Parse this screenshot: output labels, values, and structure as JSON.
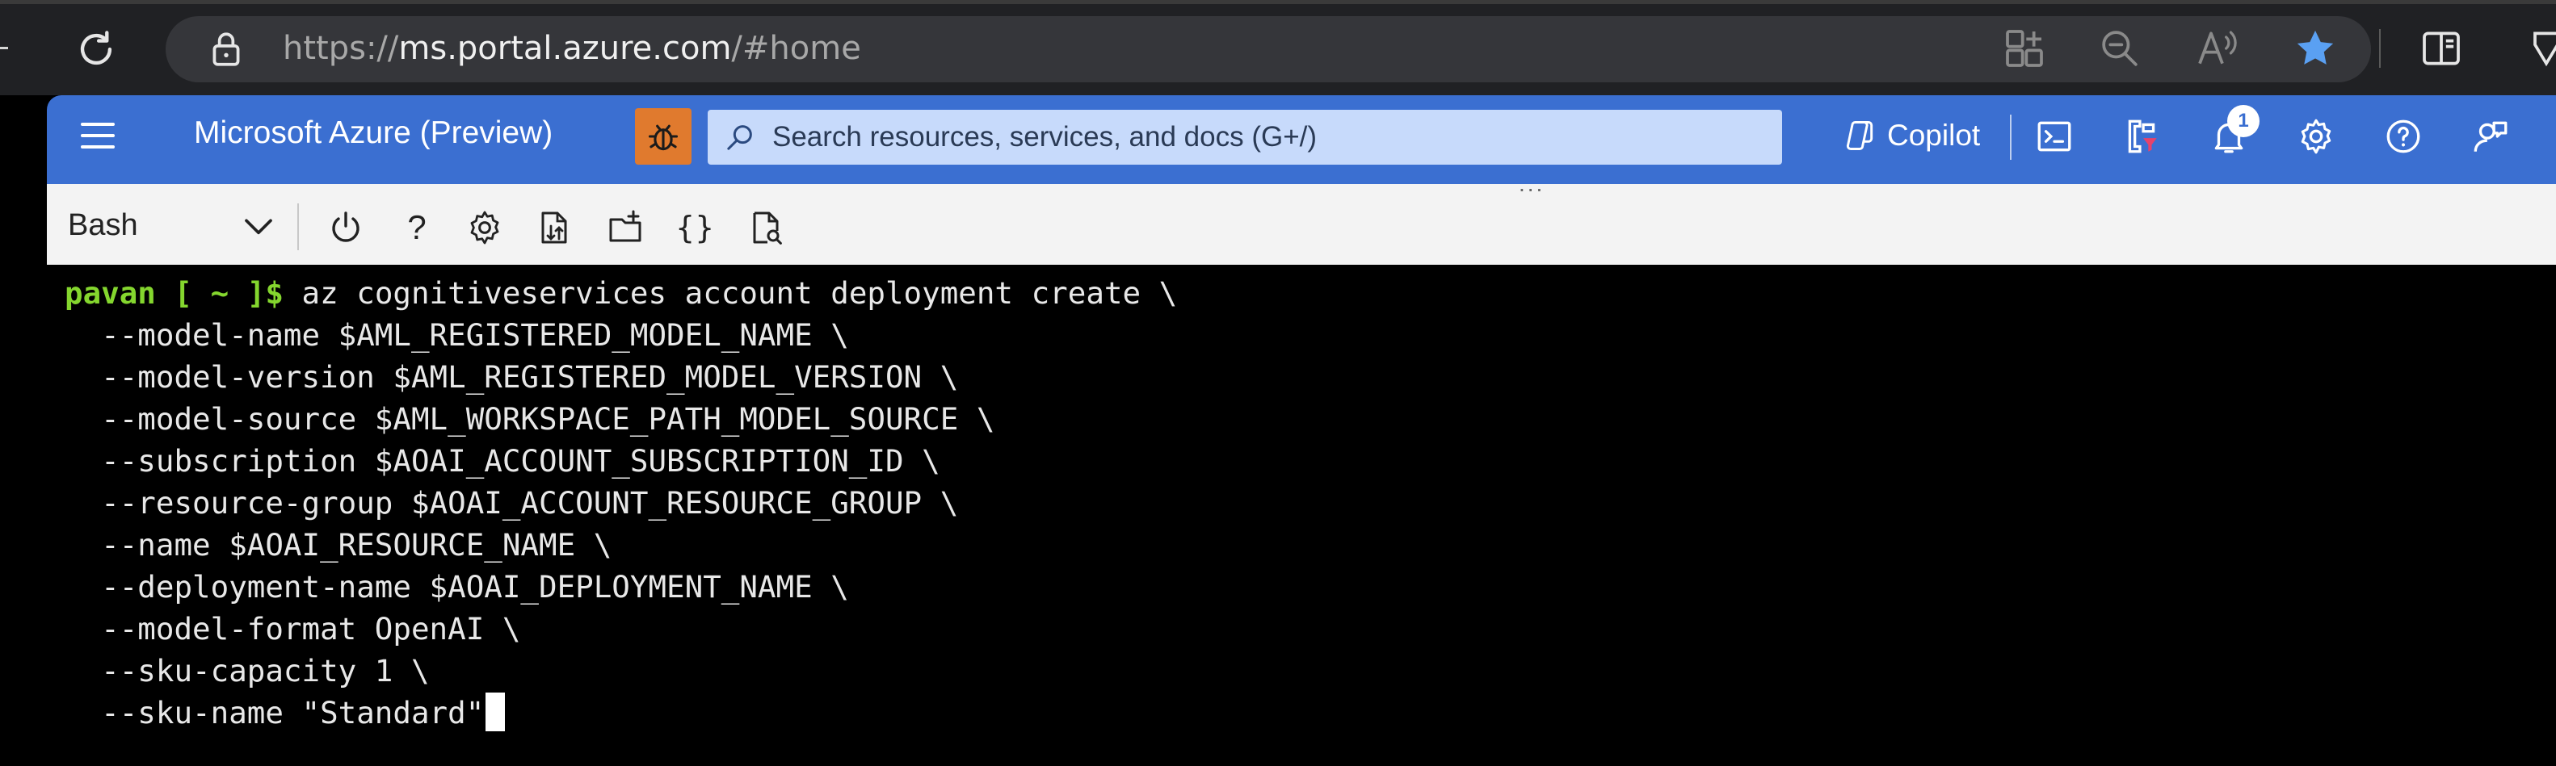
{
  "browser": {
    "url_scheme": "https://",
    "url_host": "ms.portal.azure.com",
    "url_path": "/#home"
  },
  "header": {
    "title": "Microsoft Azure (Preview)",
    "search_placeholder": "Search resources, services, and docs (G+/)",
    "copilot_label": "Copilot",
    "notification_count": "1",
    "brand_color": "#3b6fd1"
  },
  "shell": {
    "selected_shell": "Bash",
    "toolbar_dots": "...",
    "help_label": "?",
    "braces_label": "{}"
  },
  "terminal": {
    "prompt_user": "pavan",
    "prompt_dir": " [ ~ ]$",
    "lines": [
      " az cognitiveservices account deployment create \\",
      "  --model-name $AML_REGISTERED_MODEL_NAME \\",
      "  --model-version $AML_REGISTERED_MODEL_VERSION \\",
      "  --model-source $AML_WORKSPACE_PATH_MODEL_SOURCE \\",
      "  --subscription $AOAI_ACCOUNT_SUBSCRIPTION_ID \\",
      "  --resource-group $AOAI_ACCOUNT_RESOURCE_GROUP \\",
      "  --name $AOAI_RESOURCE_NAME \\",
      "  --deployment-name $AOAI_DEPLOYMENT_NAME \\",
      "  --model-format OpenAI \\",
      "  --sku-capacity 1 \\",
      "  --sku-name \"Standard\""
    ]
  }
}
